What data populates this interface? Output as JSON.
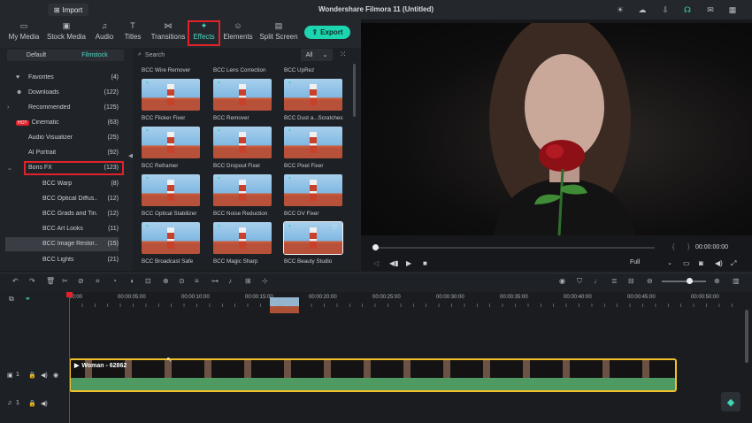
{
  "titlebar": {
    "import_label": "Import",
    "title": "Wondershare Filmora 11 (Untitled)"
  },
  "nav": {
    "tabs": [
      {
        "label": "My Media",
        "icon": "folder-icon"
      },
      {
        "label": "Stock Media",
        "icon": "cloud-icon"
      },
      {
        "label": "Audio",
        "icon": "music-icon"
      },
      {
        "label": "Titles",
        "icon": "text-icon"
      },
      {
        "label": "Transitions",
        "icon": "transition-icon"
      },
      {
        "label": "Effects",
        "icon": "sparkle-icon"
      },
      {
        "label": "Elements",
        "icon": "elements-icon"
      },
      {
        "label": "Split Screen",
        "icon": "split-screen-icon"
      }
    ],
    "active_tab": "Effects",
    "export_label": "Export"
  },
  "library": {
    "tabs": [
      "Default",
      "Filmstock"
    ],
    "active_tab": "Filmstock",
    "categories": [
      {
        "label": "Favorites",
        "count": "(4)",
        "icon": "heart-icon"
      },
      {
        "label": "Downloads",
        "count": "(122)",
        "icon": "user-icon"
      },
      {
        "label": "Recommended",
        "count": "(125)",
        "expandable": true
      },
      {
        "label": "Cinematic",
        "count": "(63)",
        "badge": "HOT"
      },
      {
        "label": "Audio Visualizer",
        "count": "(25)"
      },
      {
        "label": "AI Portrait",
        "count": "(92)"
      },
      {
        "label": "Boris FX",
        "count": "(123)",
        "expanded": true
      },
      {
        "label": "BCC Warp",
        "count": "(8)"
      },
      {
        "label": "BCC Optical Diffus...",
        "count": "(12)"
      },
      {
        "label": "BCC Grads and Tin...",
        "count": "(12)"
      },
      {
        "label": "BCC Art Looks",
        "count": "(11)"
      },
      {
        "label": "BCC Image Restor...",
        "count": "(15)",
        "selected": true
      },
      {
        "label": "BCC Lights",
        "count": "(21)"
      }
    ]
  },
  "effects": {
    "search_placeholder": "Search",
    "filter_value": "All",
    "top_labels": [
      "BCC Wire Remover",
      "BCC Lens Correction",
      "BCC UpRez"
    ],
    "items": [
      "BCC Flicker Fixer",
      "BCC Remover",
      "BCC Dust a...Scratches",
      "BCC Reframer",
      "BCC Dropout Fixer",
      "BCC Pixel Fixer",
      "BCC Optical Stabilizer",
      "BCC Noise Reduction",
      "BCC DV Fixer",
      "BCC Broadcast Safe",
      "BCC Magic Sharp",
      "BCC Beauty Studio"
    ]
  },
  "preview": {
    "timecode": "00:00:00:00",
    "quality": "Full",
    "progress": 0
  },
  "timeline": {
    "ruler": [
      "00:00",
      "00:00:05:00",
      "00:00:10:00",
      "00:00:15:00",
      "00:00:20:00",
      "00:00:25:00",
      "00:00:30:00",
      "00:00:35:00",
      "00:00:40:00",
      "00:00:45:00",
      "00:00:50:00"
    ],
    "clip_name": "Woman - 62862",
    "video_track": "1",
    "audio_track": "1",
    "zoom_level": 0.6
  },
  "colors": {
    "accent": "#1dd6b0",
    "highlight": "#e0222a",
    "clip_border": "#f0c02a",
    "audio_wave": "#4f9a63"
  }
}
